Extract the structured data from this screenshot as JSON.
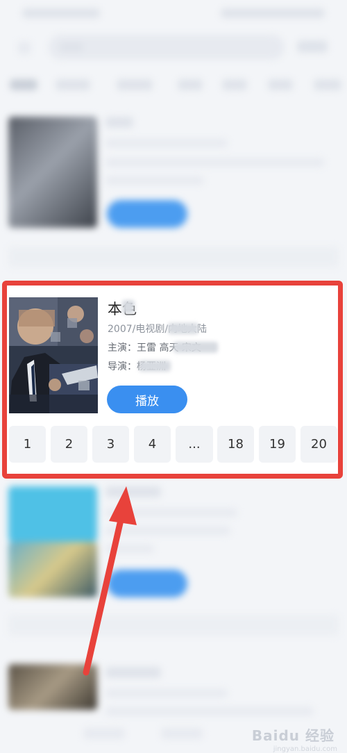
{
  "focus_card": {
    "title": "本色",
    "meta": "2007/电视剧/内地大陆",
    "cast": "主演：王雷 高天 宋文",
    "director": "导演：杨亚洲",
    "play_label": "播放",
    "episodes": [
      "1",
      "2",
      "3",
      "4",
      "...",
      "18",
      "19",
      "20"
    ]
  },
  "watermark": {
    "brand": "Baidu 经验",
    "url": "jingyan.baidu.com"
  },
  "colors": {
    "highlight_border": "#e8423b",
    "play_button": "#3a8ff0",
    "arrow": "#e8423b"
  }
}
